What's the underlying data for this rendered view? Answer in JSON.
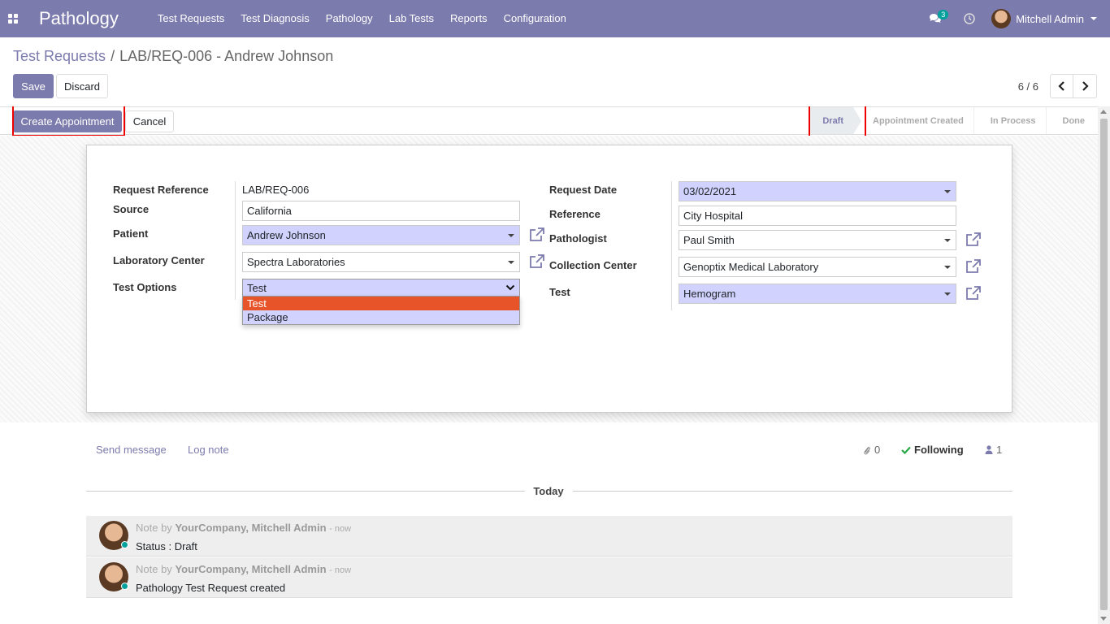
{
  "navbar": {
    "app_title": "Pathology",
    "menu": [
      "Test Requests",
      "Test Diagnosis",
      "Pathology",
      "Lab Tests",
      "Reports",
      "Configuration"
    ],
    "chat_count": "3",
    "user_name": "Mitchell Admin",
    "color": "#7c7bad"
  },
  "breadcrumb": {
    "parent": "Test Requests",
    "separator": "/",
    "current": "LAB/REQ-006 - Andrew Johnson"
  },
  "actions": {
    "save": "Save",
    "discard": "Discard"
  },
  "pager": {
    "value": "6 / 6"
  },
  "statusbar": {
    "create_appointment": "Create Appointment",
    "cancel": "Cancel",
    "stages": [
      "Draft",
      "Appointment Created",
      "In Process",
      "Done"
    ],
    "active_stage": "Draft"
  },
  "form": {
    "left": {
      "request_reference_label": "Request Reference",
      "request_reference_value": "LAB/REQ-006",
      "source_label": "Source",
      "source_value": "California",
      "patient_label": "Patient",
      "patient_value": "Andrew Johnson",
      "lab_center_label": "Laboratory Center",
      "lab_center_value": "Spectra Laboratories",
      "test_options_label": "Test Options",
      "test_options_value": "Test",
      "test_options_choices": [
        "Test",
        "Package"
      ]
    },
    "right": {
      "request_date_label": "Request Date",
      "request_date_value": "03/02/2021",
      "reference_label": "Reference",
      "reference_value": "City Hospital",
      "pathologist_label": "Pathologist",
      "pathologist_value": "Paul Smith",
      "collection_center_label": "Collection Center",
      "collection_center_value": "Genoptix Medical Laboratory",
      "test_label": "Test",
      "test_value": "Hemogram"
    }
  },
  "chatter": {
    "send_message": "Send message",
    "log_note": "Log note",
    "attachments": "0",
    "following": "Following",
    "followers": "1",
    "today": "Today",
    "messages": [
      {
        "prefix": "Note by",
        "author": "YourCompany, Mitchell Admin",
        "time": "- now",
        "body": "Status : Draft"
      },
      {
        "prefix": "Note by",
        "author": "YourCompany, Mitchell Admin",
        "time": "- now",
        "body": "Pathology Test Request created"
      }
    ]
  }
}
